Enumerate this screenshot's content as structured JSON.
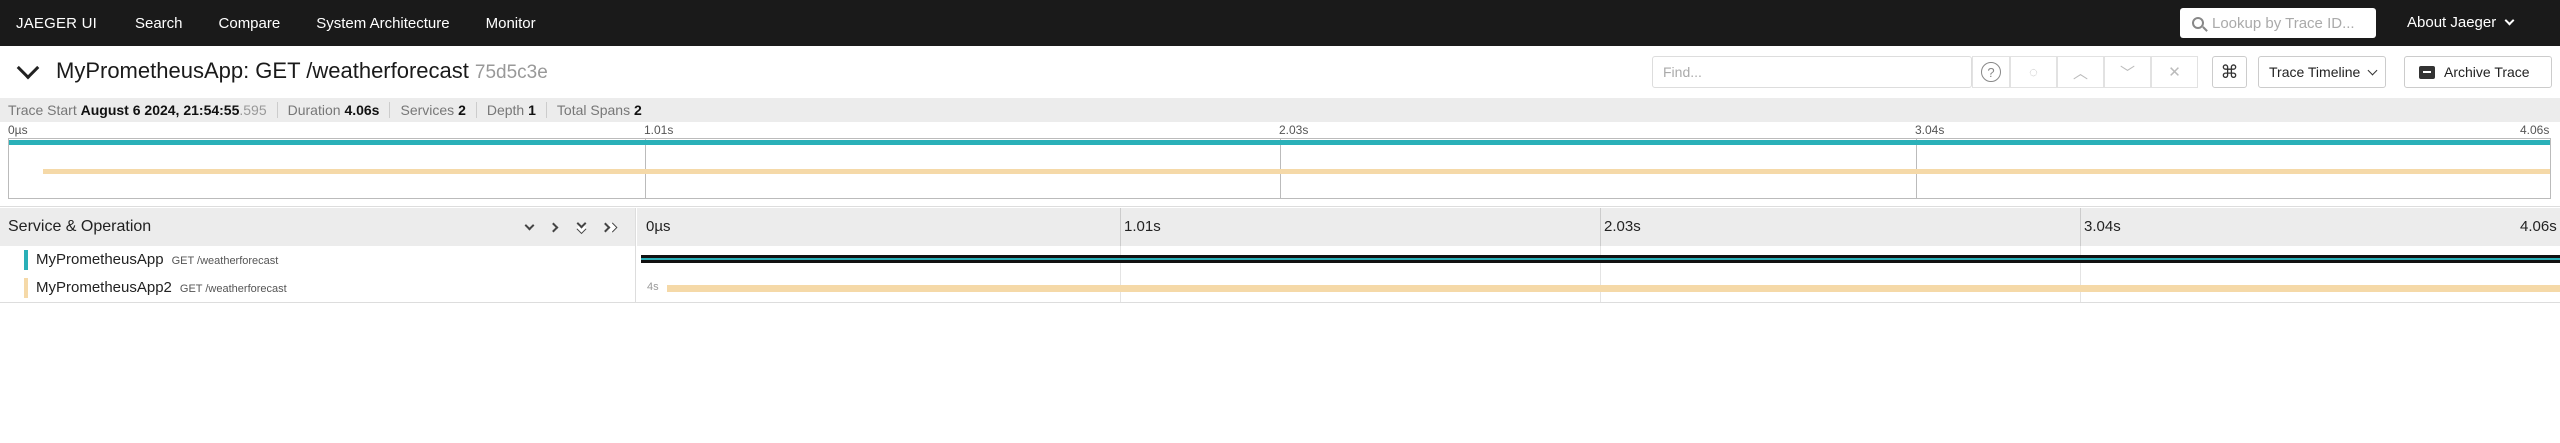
{
  "nav": {
    "brand": "JAEGER UI",
    "links": [
      "Search",
      "Compare",
      "System Architecture",
      "Monitor"
    ],
    "lookup_placeholder": "Lookup by Trace ID...",
    "about": "About Jaeger"
  },
  "trace": {
    "title": "MyPrometheusApp: GET /weatherforecast",
    "id": "75d5c3e",
    "find_placeholder": "Find...",
    "help": "?",
    "keyboard_symbol": "⌘",
    "view_select": "Trace Timeline",
    "archive": "Archive Trace"
  },
  "summary": {
    "trace_start_label": "Trace Start",
    "trace_start_value": "August 6 2024, 21:54:55",
    "trace_start_ms": ".595",
    "duration_label": "Duration",
    "duration_value": "4.06s",
    "services_label": "Services",
    "services_value": "2",
    "depth_label": "Depth",
    "depth_value": "1",
    "total_spans_label": "Total Spans",
    "total_spans_value": "2"
  },
  "minimap_ticks": [
    "0µs",
    "1.01s",
    "2.03s",
    "3.04s",
    "4.06s"
  ],
  "table": {
    "service_header": "Service & Operation",
    "ticks": [
      "0µs",
      "1.01s",
      "2.03s",
      "3.04s",
      "4.06s"
    ]
  },
  "spans": [
    {
      "service": "MyPrometheusApp",
      "operation": "GET /weatherforecast",
      "color": "#2ab0b8",
      "duration_label": ""
    },
    {
      "service": "MyPrometheusApp2",
      "operation": "GET /weatherforecast",
      "color": "#f5d9a8",
      "duration_label": "4s"
    }
  ]
}
